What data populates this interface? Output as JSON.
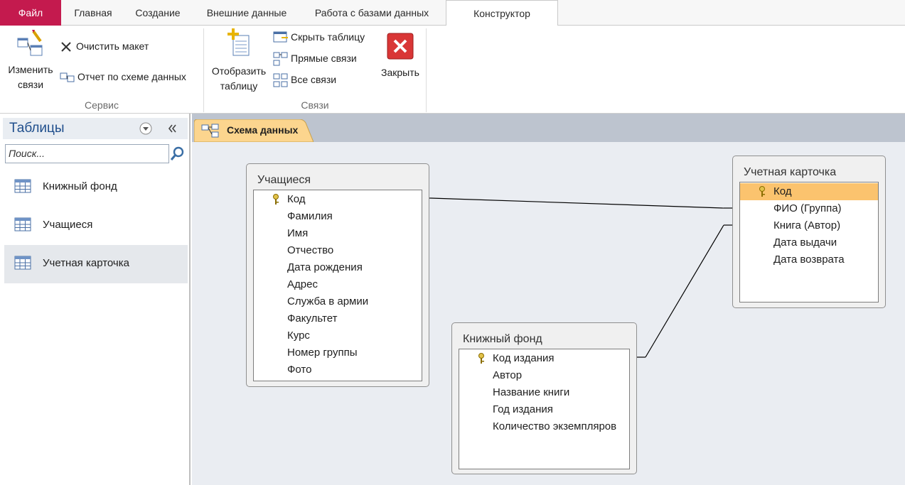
{
  "ribbon_tabs": {
    "file": "Файл",
    "home": "Главная",
    "create": "Создание",
    "external": "Внешние данные",
    "dbtools": "Работа с базами данных",
    "design": "Конструктор"
  },
  "ribbon": {
    "edit_relations": "Изменить связи",
    "clear_layout": "Очистить макет",
    "relationship_report": "Отчет по схеме данных",
    "group_tools": "Сервис",
    "show_table": "Отобразить таблицу",
    "hide_table": "Скрыть таблицу",
    "direct_relations": "Прямые связи",
    "all_relations": "Все связи",
    "close": "Закрыть",
    "group_relations": "Связи"
  },
  "nav": {
    "title": "Таблицы",
    "search_placeholder": "Поиск...",
    "items": [
      {
        "label": "Книжный фонд"
      },
      {
        "label": "Учащиеся"
      },
      {
        "label": "Учетная карточка"
      }
    ]
  },
  "document_tab": "Схема данных",
  "tables": {
    "students": {
      "title": "Учащиеся",
      "fields": [
        "Код",
        "Фамилия",
        "Имя",
        "Отчество",
        "Дата рождения",
        "Адрес",
        "Служба в армии",
        "Факультет",
        "Курс",
        "Номер группы",
        "Фото"
      ]
    },
    "card": {
      "title": "Учетная карточка",
      "fields": [
        "Код",
        "ФИО (Группа)",
        "Книга (Автор)",
        "Дата выдачи",
        "Дата возврата"
      ]
    },
    "books": {
      "title": "Книжный фонд",
      "fields": [
        "Код издания",
        "Автор",
        "Название книги",
        "Год издания",
        "Количество экземпляров"
      ]
    }
  },
  "colors": {
    "file_tab": "#c41a4e",
    "selected_field": "#fbc36e",
    "nav_title": "#1f4e8c"
  }
}
